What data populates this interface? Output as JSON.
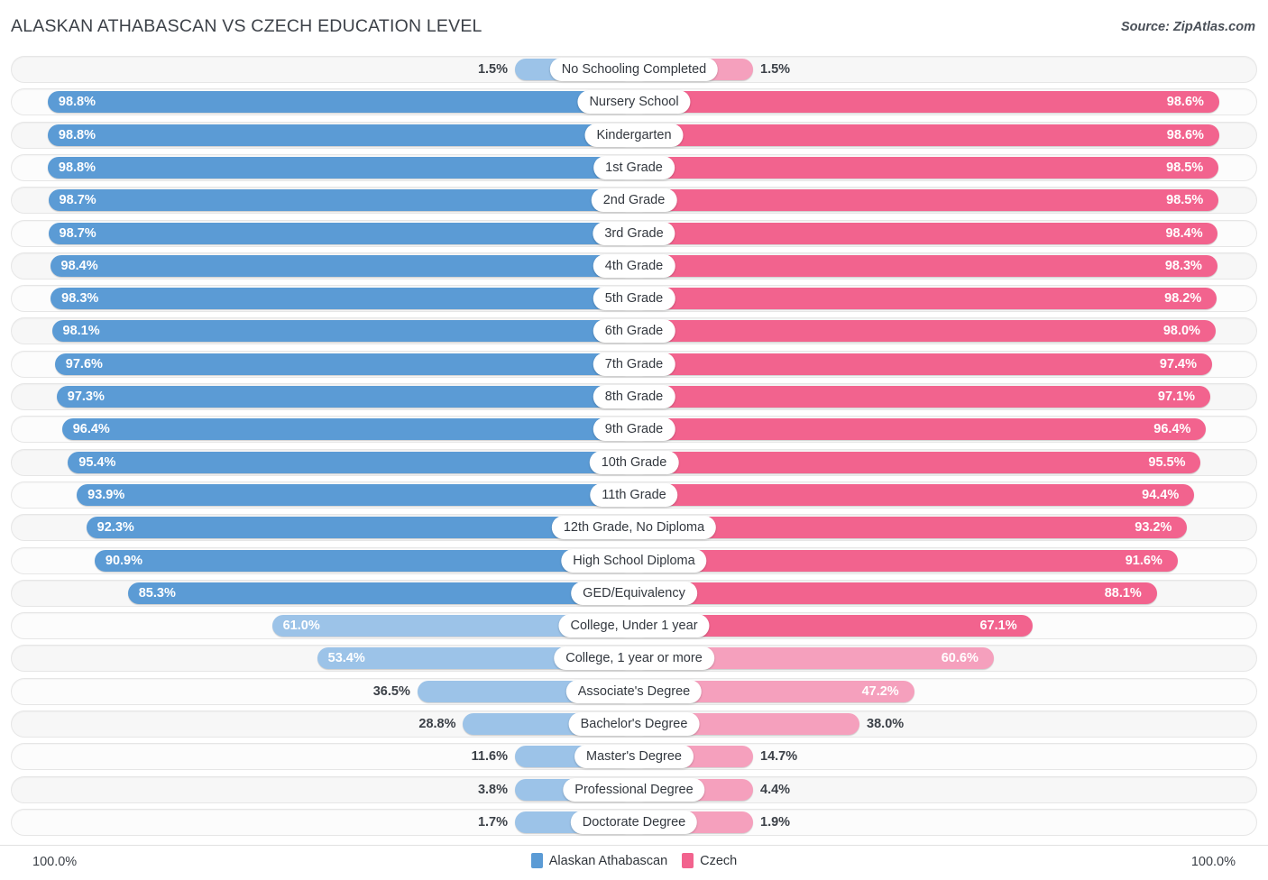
{
  "header": {
    "title": "ALASKAN ATHABASCAN VS CZECH EDUCATION LEVEL",
    "source": "Source: ZipAtlas.com"
  },
  "footer": {
    "axis_left": "100.0%",
    "axis_right": "100.0%",
    "legend": [
      {
        "label": "Alaskan Athabascan",
        "color": "#5b9bd5",
        "name": "legend-swatch-alaskan-athabascan"
      },
      {
        "label": "Czech",
        "color": "#f2638e",
        "name": "legend-swatch-czech"
      }
    ]
  },
  "colors": {
    "left_strong": "#5b9bd5",
    "left_light": "#9cc3e8",
    "right_strong": "#f2638e",
    "right_light": "#f5a0bd",
    "track": "#f7f7f7",
    "track_border": "#e6e6e6",
    "text": "#3c4148"
  },
  "chart_data": {
    "type": "bar",
    "title": "ALASKAN ATHABASCAN VS CZECH EDUCATION LEVEL",
    "subtitle": "",
    "orientation": "horizontal-diverging",
    "xlabel": "",
    "ylabel": "",
    "xlim": [
      0,
      100
    ],
    "grid": false,
    "legend_position": "bottom-center",
    "categories": [
      "No Schooling Completed",
      "Nursery School",
      "Kindergarten",
      "1st Grade",
      "2nd Grade",
      "3rd Grade",
      "4th Grade",
      "5th Grade",
      "6th Grade",
      "7th Grade",
      "8th Grade",
      "9th Grade",
      "10th Grade",
      "11th Grade",
      "12th Grade, No Diploma",
      "High School Diploma",
      "GED/Equivalency",
      "College, Under 1 year",
      "College, 1 year or more",
      "Associate's Degree",
      "Bachelor's Degree",
      "Master's Degree",
      "Professional Degree",
      "Doctorate Degree"
    ],
    "series": [
      {
        "name": "Alaskan Athabascan",
        "color": "#5b9bd5",
        "values": [
          1.5,
          98.8,
          98.8,
          98.8,
          98.7,
          98.7,
          98.4,
          98.3,
          98.1,
          97.6,
          97.3,
          96.4,
          95.4,
          93.9,
          92.3,
          90.9,
          85.3,
          61.0,
          53.4,
          36.5,
          28.8,
          11.6,
          3.8,
          1.7
        ],
        "labels": [
          "1.5%",
          "98.8%",
          "98.8%",
          "98.8%",
          "98.7%",
          "98.7%",
          "98.4%",
          "98.3%",
          "98.1%",
          "97.6%",
          "97.3%",
          "96.4%",
          "95.4%",
          "93.9%",
          "92.3%",
          "90.9%",
          "85.3%",
          "61.0%",
          "53.4%",
          "36.5%",
          "28.8%",
          "11.6%",
          "3.8%",
          "1.7%"
        ]
      },
      {
        "name": "Czech",
        "color": "#f2638e",
        "values": [
          1.5,
          98.6,
          98.6,
          98.5,
          98.5,
          98.4,
          98.3,
          98.2,
          98.0,
          97.4,
          97.1,
          96.4,
          95.5,
          94.4,
          93.2,
          91.6,
          88.1,
          67.1,
          60.6,
          47.2,
          38.0,
          14.7,
          4.4,
          1.9
        ],
        "labels": [
          "1.5%",
          "98.6%",
          "98.6%",
          "98.5%",
          "98.5%",
          "98.4%",
          "98.3%",
          "98.2%",
          "98.0%",
          "97.4%",
          "97.1%",
          "96.4%",
          "95.5%",
          "94.4%",
          "93.2%",
          "91.6%",
          "88.1%",
          "67.1%",
          "60.6%",
          "47.2%",
          "38.0%",
          "14.7%",
          "4.4%",
          "1.9%"
        ]
      }
    ]
  }
}
